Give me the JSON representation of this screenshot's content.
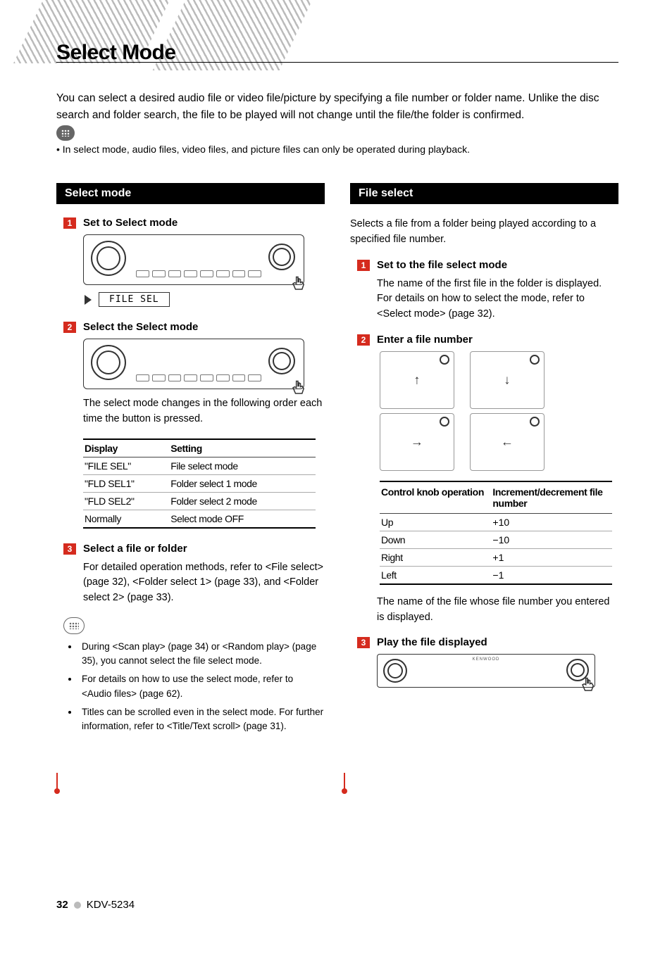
{
  "page_title": "Select Mode",
  "intro": "You can select a desired audio file or video file/picture by specifying a file number or folder name. Unlike the disc search and folder search, the file to be played will not change until the file/the folder is confirmed.",
  "top_note_bullet": "• In select mode, audio files, video files, and picture files can only be operated during playback.",
  "left": {
    "section_header": "Select mode",
    "step1_label": "Set to Select mode",
    "file_sel_display": "FILE SEL",
    "step2_label": "Select the Select mode",
    "step2_body": "The select mode changes in the following order each time the button is pressed.",
    "table_head_1": "Display",
    "table_head_2": "Setting",
    "table_rows": [
      {
        "display": "\"FILE SEL\"",
        "setting": "File select mode"
      },
      {
        "display": "\"FLD SEL1\"",
        "setting": "Folder select 1 mode"
      },
      {
        "display": "\"FLD SEL2\"",
        "setting": "Folder select 2 mode"
      },
      {
        "display": "Normally",
        "setting": "Select mode OFF"
      }
    ],
    "step3_label": "Select a file or folder",
    "step3_body": "For detailed operation methods, refer to <File select> (page 32), <Folder select 1> (page 33), and <Folder select 2> (page 33).",
    "notes": [
      "During <Scan play> (page 34) or <Random play> (page 35), you cannot select the file select mode.",
      "For details on how to use the select mode, refer to <Audio files> (page 62).",
      "Titles can be scrolled even in the select mode. For further information, refer to <Title/Text scroll> (page 31)."
    ]
  },
  "right": {
    "section_header": "File select",
    "intro": "Selects a file from a folder being played according to a specified file number.",
    "step1_label": "Set to the file select mode",
    "step1_body": "The name of the first file in the folder is displayed.\nFor details on how to select the mode, refer to <Select mode> (page 32).",
    "step2_label": "Enter a file number",
    "control_head_1": "Control knob operation",
    "control_head_2": "Increment/decrement file number",
    "control_rows": [
      {
        "op": "Up",
        "val": "+10"
      },
      {
        "op": "Down",
        "val": "−10"
      },
      {
        "op": "Right",
        "val": "+1"
      },
      {
        "op": "Left",
        "val": "−1"
      }
    ],
    "step2_after": "The name of the file whose file number you entered is displayed.",
    "step3_label": "Play the file displayed",
    "device_brand": "KENWOOD"
  },
  "footer": {
    "page": "32",
    "model": "KDV-5234"
  }
}
